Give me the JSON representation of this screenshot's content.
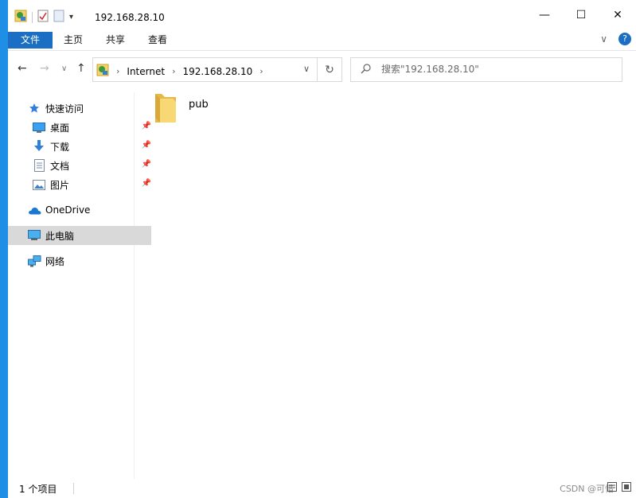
{
  "window": {
    "title": "192.168.28.10",
    "caption": {
      "minimize": "—",
      "maximize": "☐",
      "close": "✕"
    }
  },
  "ribbon": {
    "tabs": [
      "文件",
      "主页",
      "共享",
      "查看"
    ],
    "expand_chevron": "∨",
    "help": "?"
  },
  "navigation": {
    "back": "←",
    "forward": "→",
    "recent": "∨",
    "up": "↑",
    "breadcrumbs": [
      "Internet",
      "192.168.28.10"
    ],
    "separator": "›",
    "dropdown": "∨",
    "refresh": "↻"
  },
  "search": {
    "placeholder": "搜索\"192.168.28.10\""
  },
  "sidebar": {
    "items": [
      {
        "label": "快速访问",
        "icon": "star-icon"
      },
      {
        "label": "桌面",
        "icon": "desktop-icon",
        "pinned": true
      },
      {
        "label": "下载",
        "icon": "download-icon",
        "pinned": true
      },
      {
        "label": "文档",
        "icon": "document-icon",
        "pinned": true
      },
      {
        "label": "图片",
        "icon": "pictures-icon",
        "pinned": true
      },
      {
        "label": "OneDrive",
        "icon": "cloud-icon"
      },
      {
        "label": "此电脑",
        "icon": "computer-icon",
        "selected": true
      },
      {
        "label": "网络",
        "icon": "network-icon"
      }
    ]
  },
  "content": {
    "items": [
      {
        "name": "pub",
        "icon": "folder-icon"
      }
    ]
  },
  "status": {
    "count": "1 个项目",
    "watermark": "CSDN @可惜"
  },
  "colors": {
    "accent": "#1a6ec4",
    "desktop_bg": "#1f8fe6",
    "selection": "#d9d9d9"
  }
}
